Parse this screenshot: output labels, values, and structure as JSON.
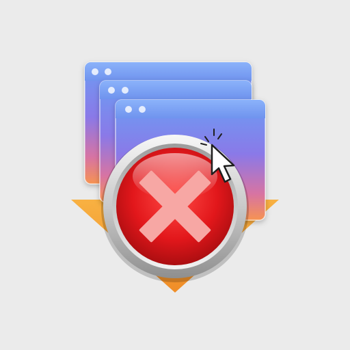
{
  "icon": {
    "name": "close-windows-app-icon",
    "elements": [
      "download-arrow-icon",
      "browser-window-icon",
      "close-x-icon",
      "mouse-pointer-icon"
    ],
    "windows_count": 3,
    "window_traffic_dots": 2
  },
  "colors": {
    "background": "#ebebeb",
    "window_top": "#6f9af0",
    "window_bottom": "#f3925a",
    "arrow": "#f5a23a",
    "close_button": "#e8191c",
    "close_ring": "#d7d7d7",
    "x_mark": "#f5a0a0",
    "pointer_fill": "#ffffff",
    "pointer_stroke": "#222222"
  }
}
